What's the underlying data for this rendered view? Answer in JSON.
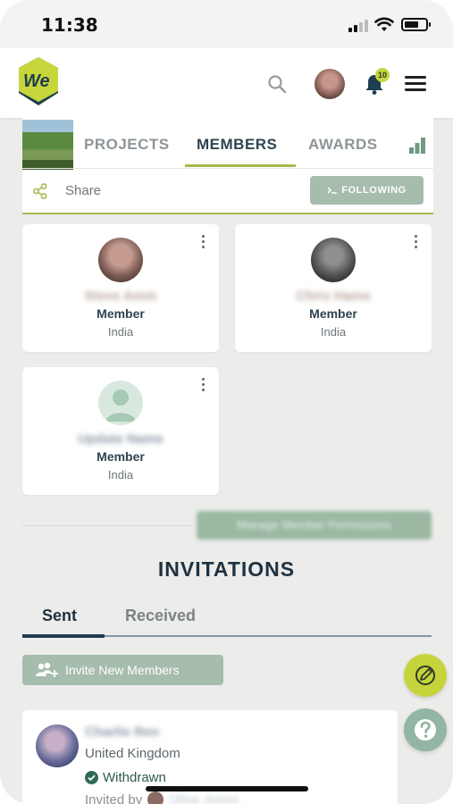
{
  "status_bar": {
    "time": "11:38"
  },
  "header": {
    "notifications_count": "10"
  },
  "tabs": [
    {
      "label": "PROJECTS",
      "active": false
    },
    {
      "label": "MEMBERS",
      "active": true
    },
    {
      "label": "AWARDS",
      "active": false
    }
  ],
  "share": {
    "label": "Share"
  },
  "follow": {
    "label": "FOLLOWING"
  },
  "members": [
    {
      "name": "Steve Amm",
      "role": "Member",
      "country": "India"
    },
    {
      "name": "Chris Hams",
      "role": "Member",
      "country": "India"
    },
    {
      "name": "Update Name",
      "role": "Member",
      "country": "India"
    }
  ],
  "manage_permissions": {
    "label": "Manage Member Permissions"
  },
  "invitations": {
    "title": "INVITATIONS",
    "tabs": [
      {
        "label": "Sent",
        "active": true
      },
      {
        "label": "Received",
        "active": false
      }
    ],
    "invite_button": "Invite New Members",
    "items": [
      {
        "name": "Charlie Ren",
        "country": "United Kingdom",
        "status": "Withdrawn",
        "invited_by_label": "Invited by",
        "invited_by": "Olive Jones"
      }
    ]
  },
  "colors": {
    "accent": "#a9b84a",
    "button": "#a6bcac",
    "dark": "#1f3240"
  }
}
